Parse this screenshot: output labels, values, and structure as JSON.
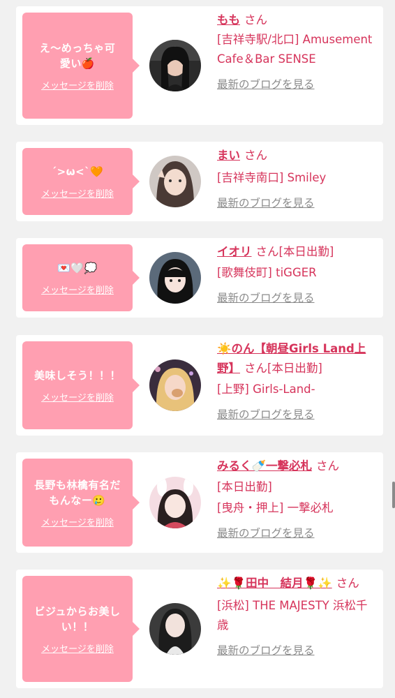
{
  "colors": {
    "pink": "#ff9fb1",
    "accent": "#d6345b",
    "grey": "#8a8a8a"
  },
  "cards": [
    {
      "message": "え〜めっちゃ可愛い🍎",
      "delete_label": "メッセージを削除",
      "name": "もも",
      "san": "さん",
      "status": "",
      "shop": "[吉祥寺駅/北口] Amusement Cafe＆Bar SENSE",
      "blog_label": "最新のブログを見る",
      "avatar_icon": "girl-photo-dark"
    },
    {
      "message": "´>ω<`🧡",
      "delete_label": "メッセージを削除",
      "name": "まい",
      "san": "さん",
      "status": "",
      "shop": "[吉祥寺南口] Smiley",
      "blog_label": "最新のブログを見る",
      "avatar_icon": "girl-photo-peace"
    },
    {
      "message": "💌🤍💭",
      "delete_label": "メッセージを削除",
      "name": "イオリ",
      "san": "さん",
      "status": "[本日出勤]",
      "shop": "[歌舞伎町] tiGGER",
      "blog_label": "最新のブログを見る",
      "avatar_icon": "girl-photo-black-hair"
    },
    {
      "message": "美味しそう！！！",
      "delete_label": "メッセージを削除",
      "name": "☀️のん【朝昼Girls Land上野】",
      "san": "さん",
      "status": "[本日出勤]",
      "shop": "[上野] Girls-Land-",
      "blog_label": "最新のブログを見る",
      "avatar_icon": "girl-photo-blonde"
    },
    {
      "message": "長野も林檎有名だもんなー🥲",
      "delete_label": "メッセージを削除",
      "name": "みるく🍼一撃必札",
      "san": "さん",
      "status": "[本日出勤]",
      "shop": "[曳舟・押上] 一撃必札",
      "blog_label": "最新のブログを見る",
      "avatar_icon": "girl-photo-bunny-ears"
    },
    {
      "message": "ビジュからお美しい！！",
      "delete_label": "メッセージを削除",
      "name": "✨🌹田中　結月🌹✨",
      "san": "さん",
      "status": "",
      "shop": "[浜松] THE MAJESTY 浜松千歳",
      "blog_label": "最新のブログを見る",
      "avatar_icon": "girl-photo-long-hair"
    }
  ]
}
